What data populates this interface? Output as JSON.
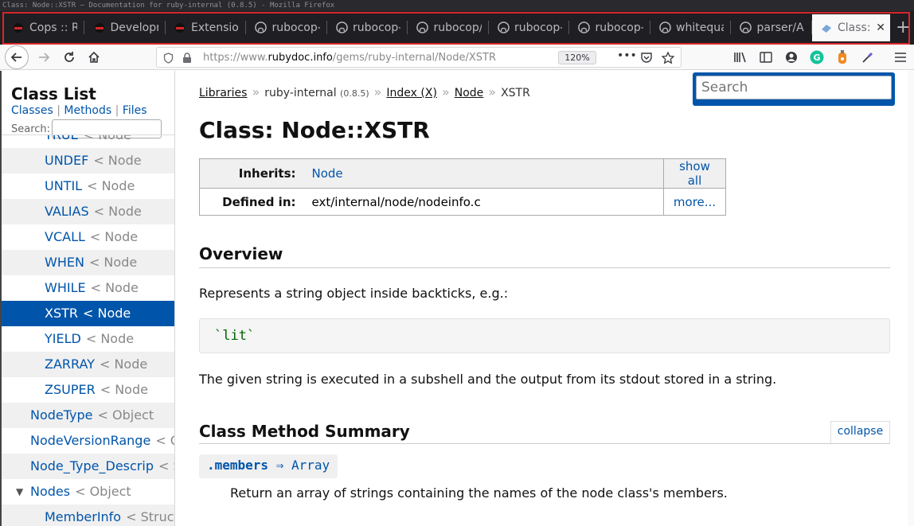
{
  "window": {
    "title": "Class: Node::XSTR — Documentation for ruby-internal (0.8.5) - Mozilla Firefox"
  },
  "tabs": [
    {
      "label": "Cops :: R",
      "icon": "rubocop-icon"
    },
    {
      "label": "Developm",
      "icon": "rubocop-icon"
    },
    {
      "label": "Extensio",
      "icon": "rubocop-icon"
    },
    {
      "label": "rubocop-",
      "icon": "github-icon"
    },
    {
      "label": "rubocop-",
      "icon": "github-icon"
    },
    {
      "label": "rubocop/",
      "icon": "github-icon"
    },
    {
      "label": "rubocop-",
      "icon": "github-icon"
    },
    {
      "label": "rubocop-",
      "icon": "github-icon"
    },
    {
      "label": "whitequa",
      "icon": "github-icon"
    },
    {
      "label": "parser/A",
      "icon": "github-icon"
    },
    {
      "label": "Class:",
      "icon": "rubydoc-icon",
      "active": true
    }
  ],
  "urlbar": {
    "prefix": "https://www.",
    "host": "rubydoc.info",
    "path": "/gems/ruby-internal/Node/XSTR",
    "zoom": "120%"
  },
  "sidebar": {
    "title": "Class List",
    "links": {
      "classes": "Classes",
      "sep": "|",
      "methods": "Methods",
      "files": "Files"
    },
    "search_label": "Search:",
    "items": [
      {
        "name": "TRUE",
        "super": "< Node",
        "indent": 54
      },
      {
        "name": "UNDEF",
        "super": "< Node",
        "indent": 54
      },
      {
        "name": "UNTIL",
        "super": "< Node",
        "indent": 54
      },
      {
        "name": "VALIAS",
        "super": "< Node",
        "indent": 54
      },
      {
        "name": "VCALL",
        "super": "< Node",
        "indent": 54
      },
      {
        "name": "WHEN",
        "super": "< Node",
        "indent": 54
      },
      {
        "name": "WHILE",
        "super": "< Node",
        "indent": 54
      },
      {
        "name": "XSTR",
        "super": "< Node",
        "indent": 54,
        "selected": true
      },
      {
        "name": "YIELD",
        "super": "< Node",
        "indent": 54
      },
      {
        "name": "ZARRAY",
        "super": "< Node",
        "indent": 54
      },
      {
        "name": "ZSUPER",
        "super": "< Node",
        "indent": 54
      },
      {
        "name": "NodeType",
        "super": "< Object",
        "indent": 36
      },
      {
        "name": "NodeVersionRange",
        "super": "< O",
        "indent": 36
      },
      {
        "name": "Node_Type_Descrip",
        "super": "< S",
        "indent": 36
      },
      {
        "name": "Nodes",
        "super": "< Object",
        "indent": 36,
        "expanded": true
      },
      {
        "name": "MemberInfo",
        "super": "< Struct",
        "indent": 54
      }
    ]
  },
  "main": {
    "breadcrumb": {
      "libraries": "Libraries",
      "sep": "»",
      "gem": "ruby-internal",
      "version": "(0.8.5)",
      "index": "Index (X)",
      "node": "Node",
      "current": "XSTR"
    },
    "search_placeholder": "Search",
    "title": "Class: Node::XSTR",
    "info": {
      "inherits_label": "Inherits:",
      "inherits_value": "Node",
      "show_all": "show all",
      "defined_label": "Defined in:",
      "defined_value": "ext/internal/node/nodeinfo.c",
      "more": "more..."
    },
    "overview_heading": "Overview",
    "overview_text": "Represents a string object inside backticks, e.g.:",
    "code_example": "`lit`",
    "overview_text2": "The given string is executed in a subshell and the output from its stdout stored in a string.",
    "method_summary_heading": "Class Method Summary",
    "collapse_label": "collapse",
    "method": {
      "name": ".members",
      "arrow": "⇒",
      "returns": "Array",
      "description": "Return an array of strings containing the names of the node class's members."
    }
  }
}
